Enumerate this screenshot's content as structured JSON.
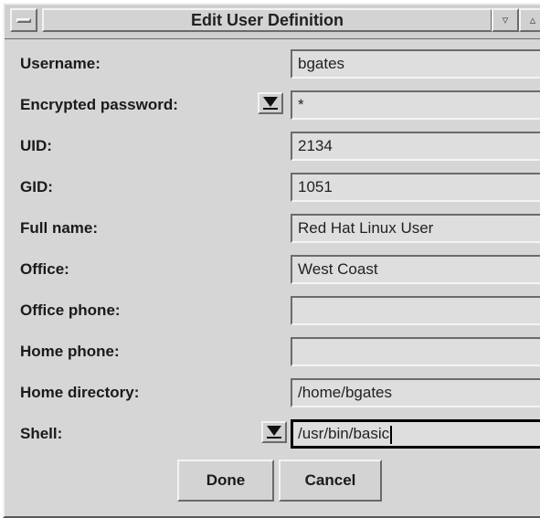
{
  "window": {
    "title": "Edit User Definition",
    "min_glyph": "▿",
    "max_glyph": "▵"
  },
  "fields": [
    {
      "label": "Username:",
      "value": "bgates"
    },
    {
      "label": "Encrypted password:",
      "value": "*",
      "dropdown": "down-triangle-icon"
    },
    {
      "label": "UID:",
      "value": "2134"
    },
    {
      "label": "GID:",
      "value": "1051"
    },
    {
      "label": "Full name:",
      "value": "Red Hat Linux User"
    },
    {
      "label": "Office:",
      "value": "West Coast"
    },
    {
      "label": "Office phone:",
      "value": ""
    },
    {
      "label": "Home phone:",
      "value": ""
    },
    {
      "label": "Home directory:",
      "value": "/home/bgates"
    },
    {
      "label": "Shell:",
      "value": "/usr/bin/basic",
      "dropdown": "down-triangle-icon",
      "focused": true
    }
  ],
  "buttons": {
    "done_label": "Done",
    "cancel_label": "Cancel"
  }
}
